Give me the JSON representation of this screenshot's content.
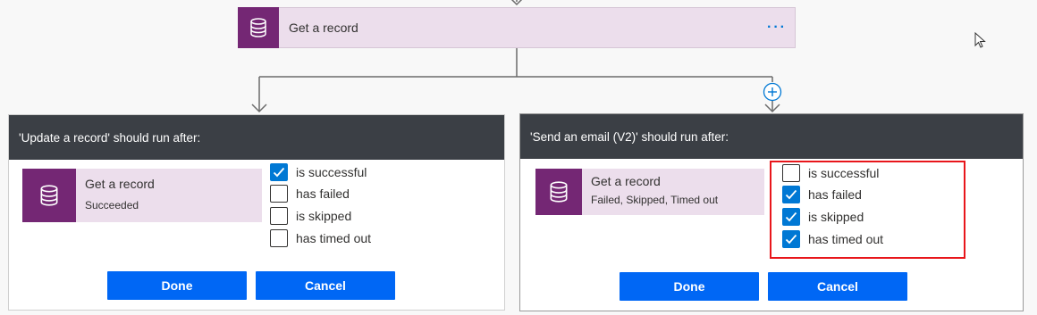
{
  "top_action": {
    "title": "Get a record",
    "more_label": "···"
  },
  "colors": {
    "accent": "#0067f5",
    "header_bg": "#3b3f45",
    "card_bg": "#ecdeec",
    "icon_bg": "#742774",
    "highlight": "#e8161b"
  },
  "left_panel": {
    "header": "'Update a record' should run after:",
    "step": {
      "title": "Get a record",
      "status": "Succeeded"
    },
    "options": [
      {
        "label": "is successful",
        "checked": true
      },
      {
        "label": "has failed",
        "checked": false
      },
      {
        "label": "is skipped",
        "checked": false
      },
      {
        "label": "has timed out",
        "checked": false
      }
    ],
    "done_label": "Done",
    "cancel_label": "Cancel"
  },
  "right_panel": {
    "header": "'Send an email (V2)' should run after:",
    "step": {
      "title": "Get a record",
      "status": "Failed, Skipped, Timed out"
    },
    "options": [
      {
        "label": "is successful",
        "checked": false
      },
      {
        "label": "has failed",
        "checked": true
      },
      {
        "label": "is skipped",
        "checked": true
      },
      {
        "label": "has timed out",
        "checked": true
      }
    ],
    "done_label": "Done",
    "cancel_label": "Cancel"
  },
  "add_step_icon": "plus-circle-icon",
  "cursor_icon": "mouse-pointer-icon"
}
